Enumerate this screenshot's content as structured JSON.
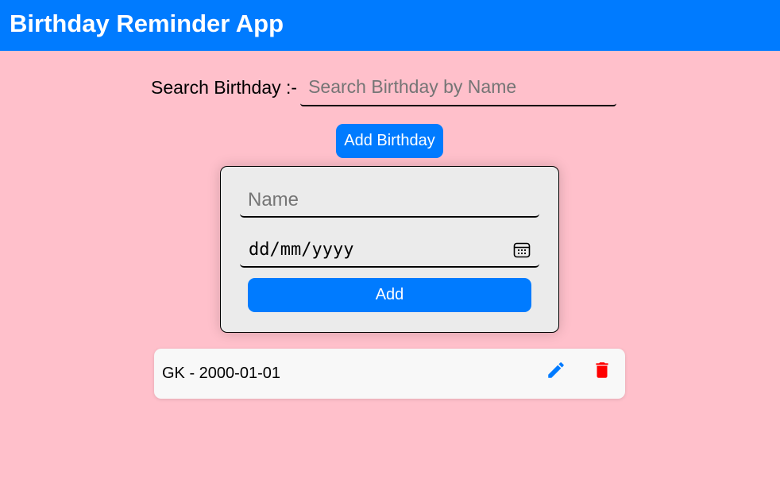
{
  "header": {
    "title": "Birthday Reminder App"
  },
  "search": {
    "label": "Search Birthday :-",
    "placeholder": "Search Birthday by Name",
    "value": ""
  },
  "toolbar": {
    "add_birthday_label": "Add Birthday"
  },
  "form": {
    "name_placeholder": "Name",
    "name_value": "",
    "date_placeholder": "dd/mm/yyyy",
    "date_icon": "calendar-icon",
    "add_label": "Add"
  },
  "birthdays": [
    {
      "text": "GK - 2000-01-01",
      "edit_icon": "pencil-icon",
      "delete_icon": "trash-icon"
    }
  ],
  "colors": {
    "accent": "#007bff",
    "background": "#ffc0cb",
    "danger": "#ff0000",
    "card": "#ebebeb",
    "list_item": "#f8f8f8"
  }
}
